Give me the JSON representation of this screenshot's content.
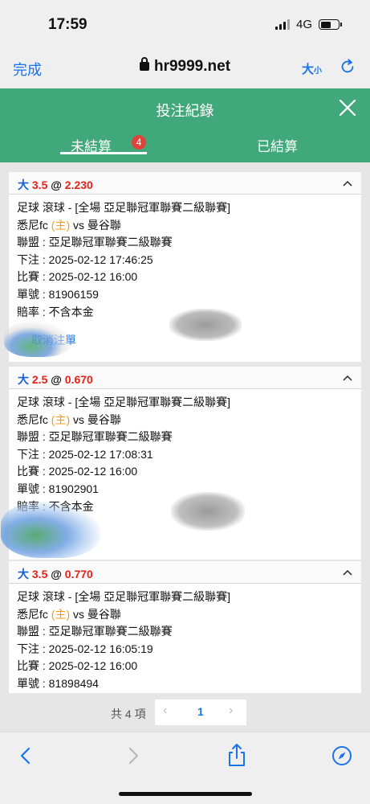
{
  "status": {
    "time": "17:59",
    "network": "4G"
  },
  "browser": {
    "done_label": "完成",
    "url": "hr9999.net",
    "text_size_label": "大",
    "text_size_small": "小"
  },
  "header": {
    "title": "投注紀錄"
  },
  "tabs": {
    "unsettled": "未結算",
    "unsettled_count": "4",
    "settled": "已結算"
  },
  "bets": [
    {
      "head_big": "大",
      "head_line": "3.5",
      "head_at": "@",
      "head_odds": "2.230",
      "sport_line": "足球 滾球 - [全場 亞足聯冠軍聯賽二級聯賽]",
      "team_home": "悉尼fc",
      "home_tag": "(主)",
      "vs": "vs",
      "team_away": "曼谷聯",
      "league": "聯盟 : 亞足聯冠軍聯賽二級聯賽",
      "bet_time": "下注 : 2025-02-12 17:46:25",
      "match_time": "比賽 : 2025-02-12 16:00",
      "ticket": "單號 : 81906159",
      "odds_note": "賠率 : 不含本金",
      "extra": "取消注單"
    },
    {
      "head_big": "大",
      "head_line": "2.5",
      "head_at": "@",
      "head_odds": "0.670",
      "sport_line": "足球 滾球 - [全場 亞足聯冠軍聯賽二級聯賽]",
      "team_home": "悉尼fc",
      "home_tag": "(主)",
      "vs": "vs",
      "team_away": "曼谷聯",
      "league": "聯盟 : 亞足聯冠軍聯賽二級聯賽",
      "bet_time": "下注 : 2025-02-12 17:08:31",
      "match_time": "比賽 : 2025-02-12 16:00",
      "ticket": "單號 : 81902901",
      "odds_note": "賠率 : 不含本金"
    },
    {
      "head_big": "大",
      "head_line": "3.5",
      "head_at": "@",
      "head_odds": "0.770",
      "sport_line": "足球 滾球 - [全場 亞足聯冠軍聯賽二級聯賽]",
      "team_home": "悉尼fc",
      "home_tag": "(主)",
      "vs": "vs",
      "team_away": "曼谷聯",
      "league": "聯盟 : 亞足聯冠軍聯賽二級聯賽",
      "bet_time": "下注 : 2025-02-12 16:05:19",
      "match_time": "比賽 : 2025-02-12 16:00",
      "ticket": "單號 : 81898494"
    }
  ],
  "pagination": {
    "total": "共 4 項",
    "prev": "‹",
    "current": "1",
    "next": "›"
  },
  "colors": {
    "header_green": "#40a87a",
    "badge_red": "#e0433a",
    "link_blue": "#1a73e8",
    "odds_red": "#e8201a",
    "home_orange": "#f39a1e"
  },
  "icons": {
    "lock": "lock-icon",
    "reload": "reload-icon",
    "close": "close-icon",
    "collapse": "chevron-up-icon",
    "back": "back-icon",
    "forward": "forward-icon",
    "share": "share-icon",
    "bookmarks": "compass-icon"
  }
}
